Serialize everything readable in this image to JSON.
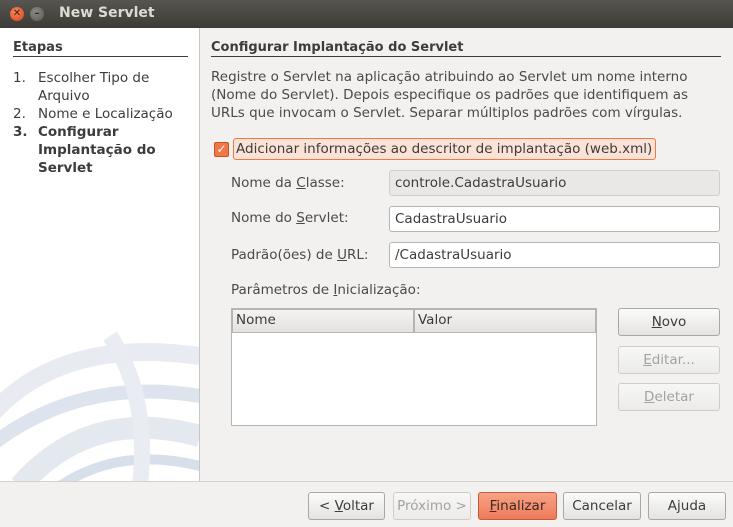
{
  "window": {
    "title": "New Servlet"
  },
  "sidebar": {
    "title": "Etapas",
    "steps": [
      {
        "num": "1.",
        "label": "Escolher Tipo de Arquivo"
      },
      {
        "num": "2.",
        "label": "Nome e Localização"
      },
      {
        "num": "3.",
        "label": "Configurar Implantação do Servlet"
      }
    ]
  },
  "main": {
    "title": "Configurar Implantação do Servlet",
    "description": "Registre o Servlet na aplicação atribuindo ao Servlet um nome interno (Nome do Servlet). Depois especifique os padrões que identifiquem as URLs que invocam o Servlet. Separar múltiplos padrões com vírgulas.",
    "checkbox": {
      "label": "Adicionar informações ao descritor de implantação (web.xml)",
      "checked": true
    },
    "fields": {
      "class_name": {
        "label_pre": "Nome da ",
        "label_u": "C",
        "label_post": "lasse:",
        "value": "controle.CadastraUsuario"
      },
      "servlet_name": {
        "label_pre": "Nome do ",
        "label_u": "S",
        "label_post": "ervlet:",
        "value": "CadastraUsuario"
      },
      "url_pattern": {
        "label_pre": "Padrão(ões) de ",
        "label_u": "U",
        "label_post": "RL:",
        "value": "/CadastraUsuario"
      }
    },
    "params": {
      "label_pre": "Parâmetros de ",
      "label_u": "I",
      "label_post": "nicialização:",
      "columns": [
        "Nome",
        "Valor"
      ]
    },
    "param_buttons": {
      "new": {
        "u": "N",
        "rest": "ovo"
      },
      "edit": {
        "u": "E",
        "rest": "ditar..."
      },
      "delete": {
        "u": "D",
        "rest": "eletar"
      }
    }
  },
  "footer": {
    "back": {
      "pre": "< ",
      "u": "V",
      "rest": "oltar"
    },
    "next": "Próximo >",
    "finish": {
      "u": "F",
      "rest": "inalizar"
    },
    "cancel": "Cancelar",
    "help": "Ajuda"
  },
  "colors": {
    "accent": "#f07746",
    "titlebar": "#3c3b37",
    "primary_button": "#ee7a5a"
  },
  "icons": {
    "close": "close-icon",
    "minimize": "minimize-icon",
    "check": "check-icon",
    "logo": "netbeans-logo"
  }
}
